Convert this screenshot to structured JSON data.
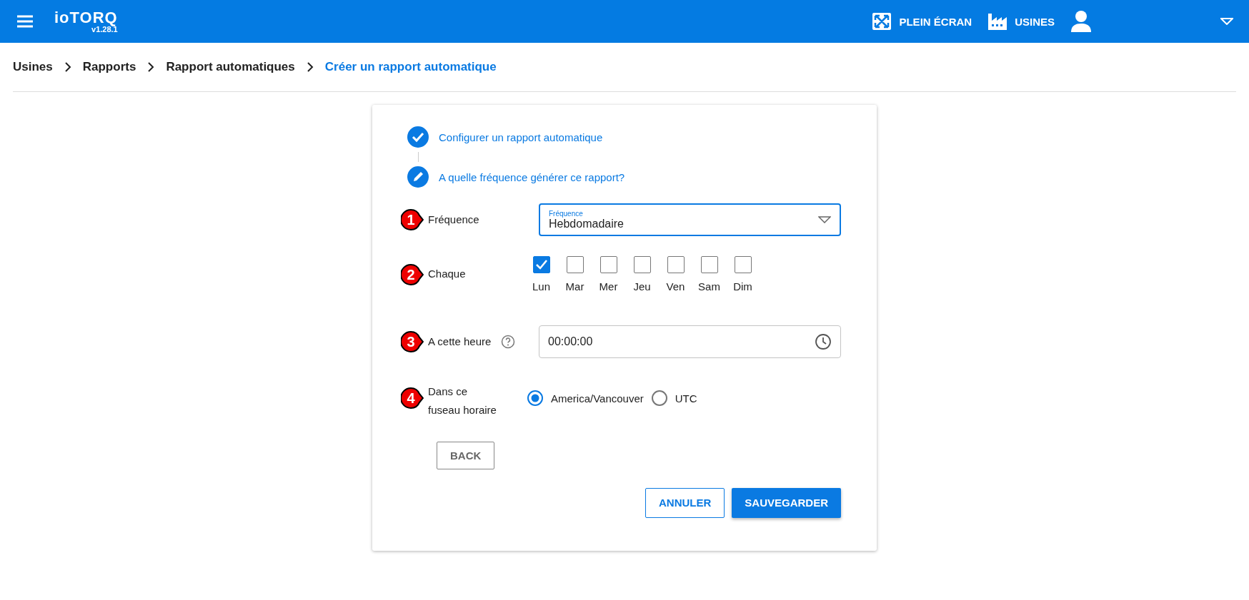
{
  "header": {
    "logo": "ioTORQ",
    "version": "v1.28.1",
    "actions": [
      {
        "kind": "fullscreen",
        "label": "PLEIN ÉCRAN"
      },
      {
        "kind": "factory",
        "label": "USINES"
      }
    ]
  },
  "breadcrumb": [
    {
      "label": "Usines",
      "current": false
    },
    {
      "label": "Rapports",
      "current": false
    },
    {
      "label": "Rapport automatiques",
      "current": false
    },
    {
      "label": "Créer un rapport automatique",
      "current": true
    }
  ],
  "steps": [
    {
      "label": "Configurer un rapport automatique",
      "kind": "done"
    },
    {
      "label": "A quelle fréquence générer ce rapport?",
      "kind": "edit"
    }
  ],
  "form": {
    "frequency": {
      "marker": "1",
      "label": "Fréquence",
      "field_label": "Fréquence",
      "value": "Hebdomadaire"
    },
    "days": {
      "marker": "2",
      "label": "Chaque",
      "items": [
        {
          "label": "Lun",
          "checked": true
        },
        {
          "label": "Mar",
          "checked": false
        },
        {
          "label": "Mer",
          "checked": false
        },
        {
          "label": "Jeu",
          "checked": false
        },
        {
          "label": "Ven",
          "checked": false
        },
        {
          "label": "Sam",
          "checked": false
        },
        {
          "label": "Dim",
          "checked": false
        }
      ]
    },
    "time": {
      "marker": "3",
      "label": "A cette heure",
      "value": "00:00:00"
    },
    "timezone": {
      "marker": "4",
      "label": "Dans ce fuseau horaire",
      "options": [
        {
          "label": "America/Vancouver",
          "selected": true
        },
        {
          "label": "UTC",
          "selected": false
        }
      ]
    }
  },
  "back_button": "BACK",
  "buttons": [
    {
      "label": "ANNULER",
      "kind": "outlined"
    },
    {
      "label": "SAUVEGARDER",
      "kind": "primary"
    }
  ]
}
